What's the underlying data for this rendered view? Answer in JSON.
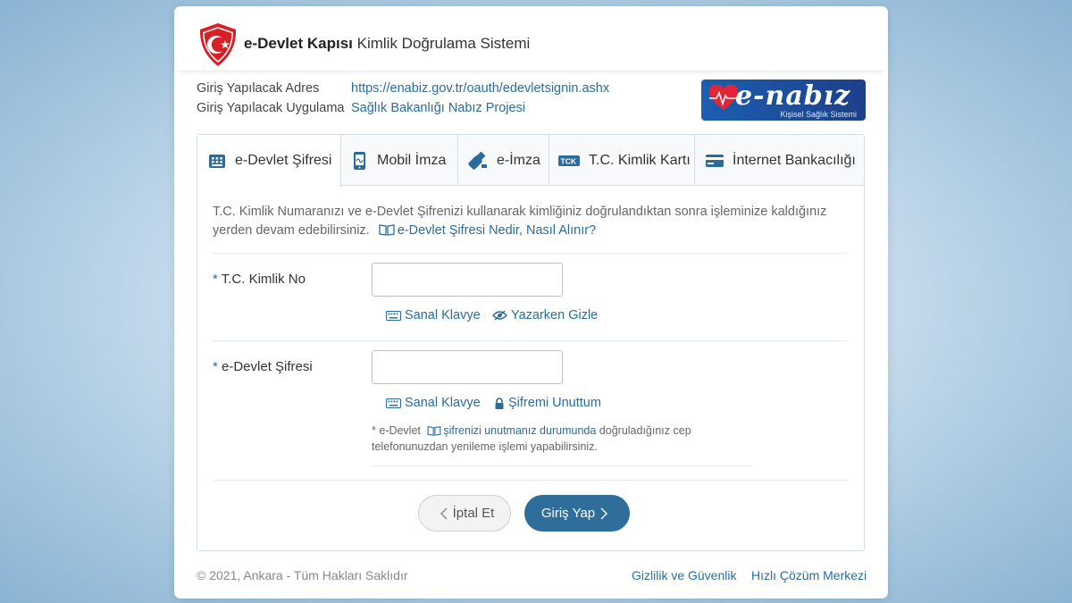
{
  "header": {
    "title_bold": "e-Devlet Kapısı",
    "title_rest": "Kimlik Doğrulama Sistemi"
  },
  "info": {
    "address_label": "Giriş Yapılacak Adres",
    "address_value": "https://enabiz.gov.tr/oauth/edevletsignin.ashx",
    "app_label": "Giriş Yapılacak Uygulama",
    "app_value": "Sağlık Bakanlığı Nabız Projesi"
  },
  "app_logo": {
    "brand": "e-nabız",
    "subtitle": "Kişisel Sağlık Sistemi"
  },
  "tabs": [
    {
      "label": "e-Devlet Şifresi",
      "icon": "keypad-icon",
      "active": true
    },
    {
      "label": "Mobil İmza",
      "icon": "mobile-signature-icon",
      "active": false
    },
    {
      "label": "e-İmza",
      "icon": "usb-token-icon",
      "active": false
    },
    {
      "label": "T.C. Kimlik Kartı",
      "icon": "id-card-icon",
      "active": false
    },
    {
      "label": "İnternet Bankacılığı",
      "icon": "credit-card-icon",
      "active": false
    }
  ],
  "description": {
    "text_1": "T.C. Kimlik Numaranızı ve e-Devlet Şifrenizi kullanarak kimliğiniz doğrulandıktan sonra işleminize kaldığınız",
    "text_2": "yerden devam edebilirsiniz.",
    "link": "e-Devlet Şifresi Nedir, Nasıl Alınır?"
  },
  "form": {
    "required_mark": "*",
    "tckn_label": "T.C. Kimlik No",
    "tckn_value": "",
    "password_label": "e-Devlet Şifresi",
    "password_value": "",
    "virtual_keyboard": "Sanal Klavye",
    "hide_while_typing": "Yazarken Gizle",
    "forgot_password": "Şifremi Unuttum",
    "note_prefix": "* e-Devlet",
    "note_link": "şifrenizi unutmanız durumunda",
    "note_suffix": "doğruladığınız cep",
    "note_line2": "telefonunuzdan yenileme işlemi yapabilirsiniz."
  },
  "buttons": {
    "cancel": "İptal Et",
    "submit": "Giriş Yap"
  },
  "footer": {
    "copyright": "© 2021, Ankara - Tüm Hakları Saklıdır",
    "privacy": "Gizlilik ve Güvenlik",
    "help": "Hızlı Çözüm Merkezi"
  },
  "colors": {
    "accent": "#2b6c9b",
    "button_primary": "#2f6d9a",
    "logo_red": "#d61f26"
  }
}
